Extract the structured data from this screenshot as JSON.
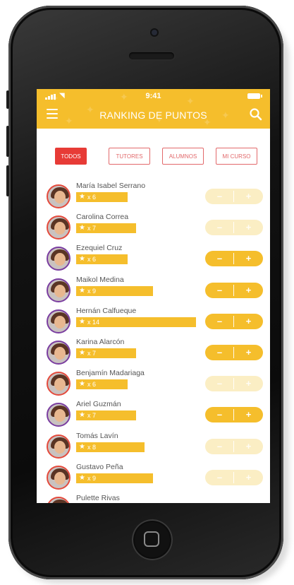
{
  "status_bar": {
    "time": "9:41"
  },
  "header": {
    "title": "RANKING DE PUNTOS"
  },
  "filters": [
    {
      "label": "TODOS",
      "active": true
    },
    {
      "label": "TUTORES",
      "active": false
    },
    {
      "label": "ALUMNOS",
      "active": false
    },
    {
      "label": "MI CURSO",
      "active": false
    }
  ],
  "colors": {
    "accent": "#f5be2c",
    "active_tab": "#e73b36",
    "tab_outline": "#e2696b"
  },
  "icons": {
    "menu": "hamburger-menu-icon",
    "search": "search-icon",
    "star": "star-icon"
  },
  "ranking": [
    {
      "name": "María Isabel Serrano",
      "points": "x 6",
      "score": 6,
      "controls_enabled": false,
      "ring": "#e44a3c"
    },
    {
      "name": "Carolina Correa",
      "points": "x 7",
      "score": 7,
      "controls_enabled": false,
      "ring": "#e44a3c"
    },
    {
      "name": "Ezequiel Cruz",
      "points": "x 6",
      "score": 6,
      "controls_enabled": true,
      "ring": "#7a3da0"
    },
    {
      "name": "Maikol Medina",
      "points": "x 9",
      "score": 9,
      "controls_enabled": true,
      "ring": "#7a3da0"
    },
    {
      "name": "Hernán Calfueque",
      "points": "x 14",
      "score": 14,
      "controls_enabled": true,
      "ring": "#7a3da0"
    },
    {
      "name": "Karina Alarcón",
      "points": "x 7",
      "score": 7,
      "controls_enabled": true,
      "ring": "#7a3da0"
    },
    {
      "name": "Benjamín Madariaga",
      "points": "x 6",
      "score": 6,
      "controls_enabled": false,
      "ring": "#e44a3c"
    },
    {
      "name": "Ariel Guzmán",
      "points": "x 7",
      "score": 7,
      "controls_enabled": true,
      "ring": "#7a3da0"
    },
    {
      "name": "Tomás Lavín",
      "points": "x 8",
      "score": 8,
      "controls_enabled": false,
      "ring": "#e44a3c"
    },
    {
      "name": "Gustavo Peña",
      "points": "x 9",
      "score": 9,
      "controls_enabled": false,
      "ring": "#e44a3c"
    },
    {
      "name": "Pulette Rivas",
      "points": "",
      "score": 0,
      "controls_enabled": false,
      "ring": "#e44a3c"
    }
  ],
  "control_labels": {
    "minus": "–",
    "plus": "+"
  }
}
